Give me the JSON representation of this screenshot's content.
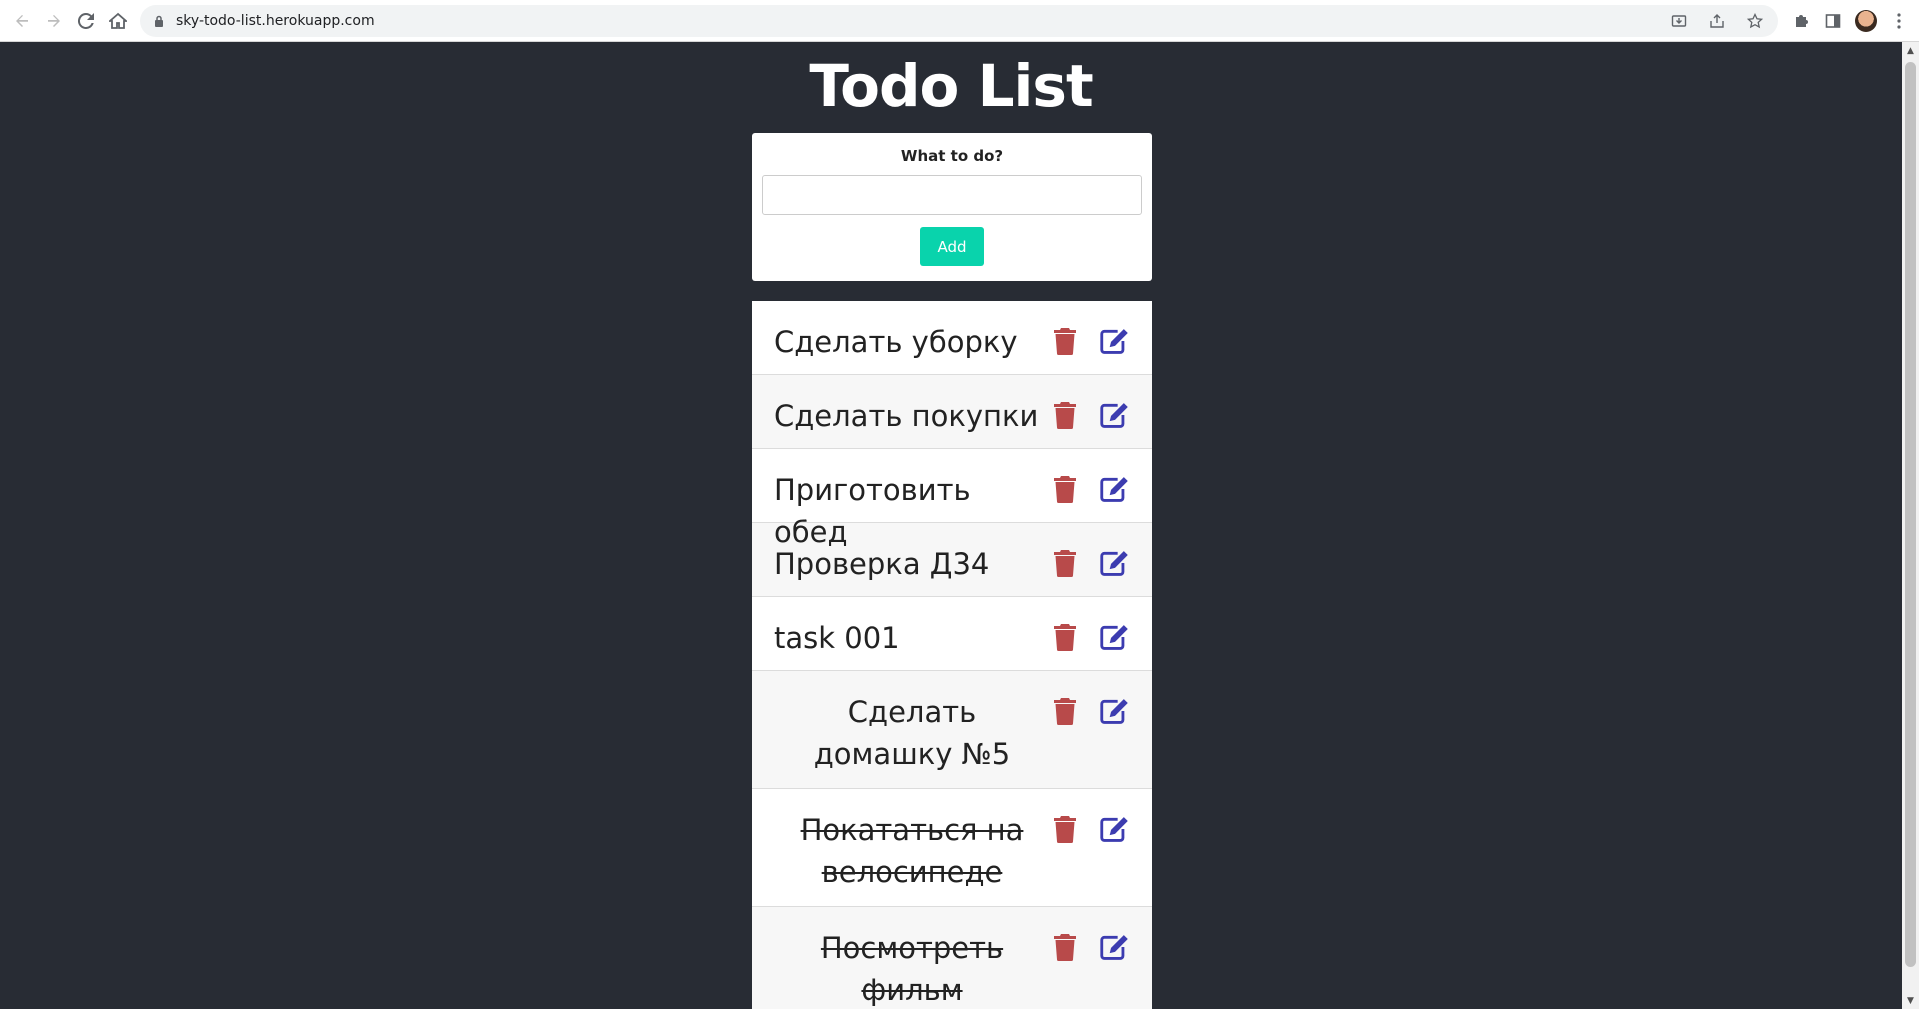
{
  "browser": {
    "url": "sky-todo-list.herokuapp.com"
  },
  "app": {
    "title": "Todo List",
    "form": {
      "label": "What to do?",
      "input_value": "",
      "add_label": "Add"
    },
    "todos": [
      {
        "text": "Сделать уборку",
        "done": false
      },
      {
        "text": "Сделать покупки",
        "done": false
      },
      {
        "text": "Приготовить обед",
        "done": false
      },
      {
        "text": "Проверка Д34",
        "done": false
      },
      {
        "text": "task 001",
        "done": false
      },
      {
        "text": "Сделать домашку №5",
        "done": false
      },
      {
        "text": "Покататься на велосипеде",
        "done": true
      },
      {
        "text": "Посмотреть фильм",
        "done": true
      }
    ],
    "colors": {
      "background": "#282c34",
      "add_button": "#09d3ac",
      "delete_icon": "#b84a4a",
      "edit_icon": "#3c3cb0"
    }
  }
}
